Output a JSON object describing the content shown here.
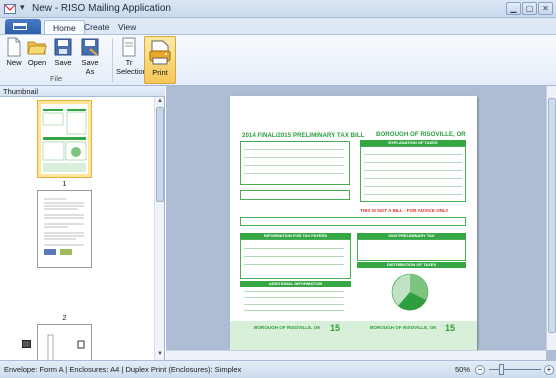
{
  "window": {
    "title": "New - RISO Mailing Application",
    "qat": "▾"
  },
  "tabs": [
    {
      "label": "Home",
      "active": true
    },
    {
      "label": "Create"
    },
    {
      "label": "View"
    }
  ],
  "ribbon": {
    "group_label": "File",
    "buttons": {
      "new": "New",
      "open": "Open",
      "save": "Save",
      "saveas": "Save As",
      "selection": "Tr Selection",
      "print": "Print"
    }
  },
  "thumbnail_panel": {
    "header": "Thumbnail",
    "pages": [
      "1",
      "2"
    ]
  },
  "document": {
    "title_left": "2014 FINAL/2015 PRELIMINARY TAX BILL",
    "title_right": "BOROUGH OF RISOVILLE, OR",
    "explanation": "EXPLANATION OF TAXES",
    "not_a_bill": "THIS IS NOT A BILL - FOR ADVICE ONLY",
    "taxpayer_info": "INFORMATION FOR TAX PAYERS",
    "prelim_tax": "2015 PRELIMINARY TAX",
    "distribution": "DISTRIBUTION OF TAXES",
    "additional": "ADDITIONAL INFORMATION",
    "stub_title": "BOROUGH OF RISOVILLE, OK",
    "stub_number": "15",
    "colors": {
      "accent": "#35a845",
      "alert": "#e03030"
    }
  },
  "status": {
    "text": "Envelope: Form A  |  Enclosures: A4  |  Duplex Print (Enclosures): Simplex",
    "zoom": "50%",
    "zoom_out": "−",
    "zoom_in": "+"
  }
}
